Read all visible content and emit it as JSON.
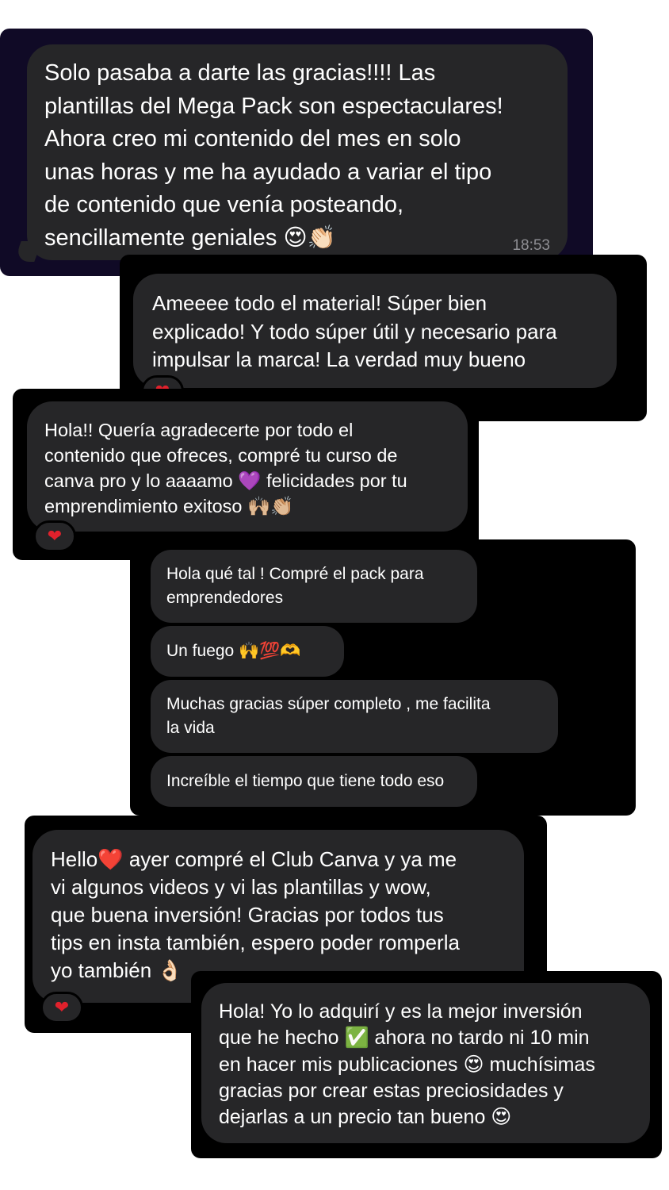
{
  "messages": [
    {
      "text": "Solo pasaba a darte las gracias!!!! Las\nplantillas del Mega Pack son espectaculares!\nAhora creo mi contenido del mes en solo\nunas horas y me ha ayudado a variar el tipo\nde contenido que venía posteando,\nsencillamente geniales 😍👏🏻",
      "time": "18:53"
    },
    {
      "text": "Ameeee todo el material! Súper bien\nexplicado! Y todo súper útil y necesario para\nimpulsar la marca! La verdad muy bueno",
      "reaction": "❤"
    },
    {
      "text": "Hola!! Quería agradecerte por todo el\ncontenido que ofreces, compré tu curso de\ncanva pro y lo aaaamo 💜 felicidades por tu\nemprendimiento exitoso 🙌🏼👏🏼",
      "reaction": "❤"
    },
    {
      "bubbles": [
        "Hola qué tal ! Compré el pack para\nemprendedores",
        "Un fuego 🙌💯🫶",
        "Muchas gracias súper completo , me facilita\nla vida",
        "Increíble el tiempo que tiene todo eso"
      ]
    },
    {
      "text": "Hello❤️ ayer compré el Club Canva y ya me\nvi algunos videos y vi las plantillas y wow,\nque buena inversión! Gracias por todos tus\ntips en insta también, espero poder romperla\nyo también 👌🏻",
      "reaction": "❤"
    },
    {
      "text": "Hola! Yo lo adquirí y es la mejor inversión\nque he hecho ✅ ahora no tardo ni 10 min\nen hacer mis publicaciones 😍 muchísimas\ngracias por crear estas preciosidades y\ndejarlas a un precio tan bueno 😍"
    }
  ],
  "colors": {
    "bubble": "#262628",
    "card_background": "#000000",
    "first_card_background": "#100a26",
    "heart": "#e0212c",
    "timestamp": "#8e8e93"
  }
}
